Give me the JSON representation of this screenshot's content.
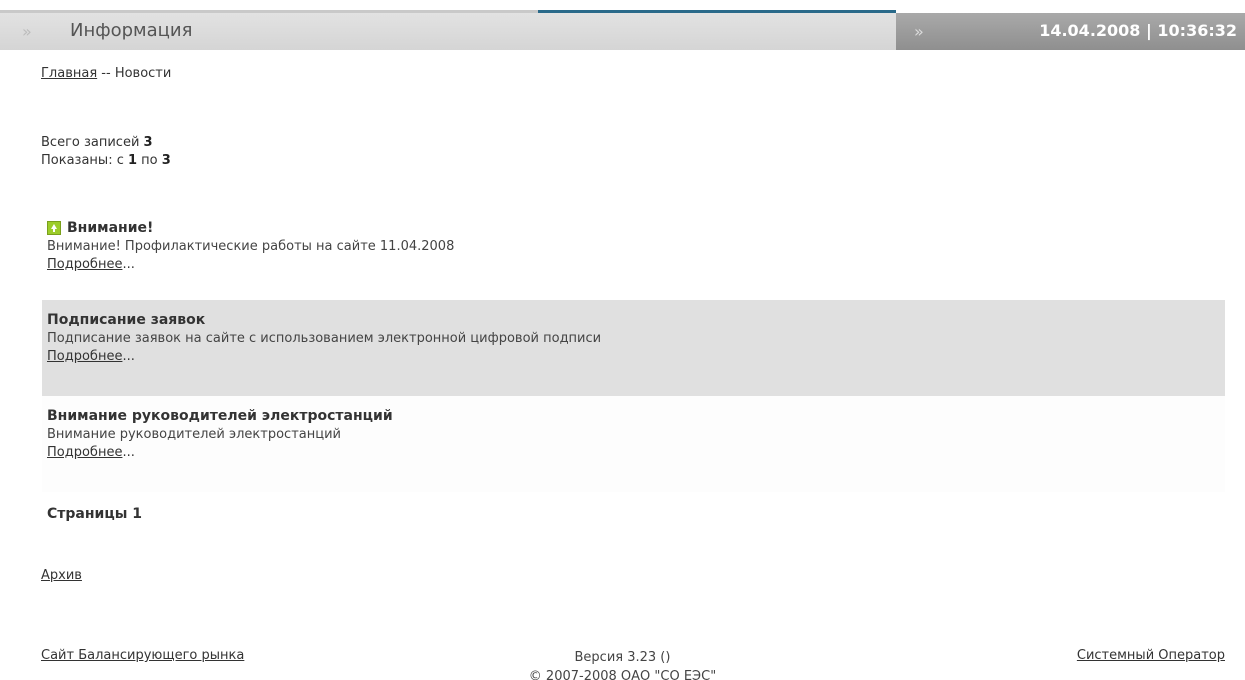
{
  "header": {
    "title": "Информация",
    "datetime": "14.04.2008 | 10:36:32",
    "chevron_icon": "double-chevron-right-icon",
    "colors": {
      "left_bar": "#d8d8d8",
      "right_bar": "#999999",
      "accent_line": "#2a6a8a"
    }
  },
  "breadcrumb": {
    "home": "Главная",
    "separator": " -- ",
    "current": "Новости"
  },
  "stats": {
    "total_label": "Всего записей ",
    "total": "3",
    "shown_label": "Показаны: с ",
    "shown_from": "1",
    "shown_to_label": " по ",
    "shown_to": "3"
  },
  "news": [
    {
      "title": "Внимание!",
      "text": "Внимание! Профилактические работы на сайте 11.04.2008",
      "more": "Подробнее",
      "icon": "pinned-up-icon"
    },
    {
      "title": "Подписание заявок",
      "text": "Подписание заявок на сайте с использованием электронной цифровой подписи",
      "more": "Подробнее"
    },
    {
      "title": "Внимание руководителей электростанций",
      "text": "Внимание руководителей электростанций",
      "more": "Подробнее"
    }
  ],
  "ellipsis": "...",
  "pages": "Страницы 1",
  "archive": "Архив",
  "footer": {
    "left_link": "Сайт Балансирующего рынка",
    "version": "Версия 3.23 ()",
    "copyright": "© 2007-2008 ОАО \"СО ЕЭС\"",
    "right_link": "Системный Оператор"
  }
}
